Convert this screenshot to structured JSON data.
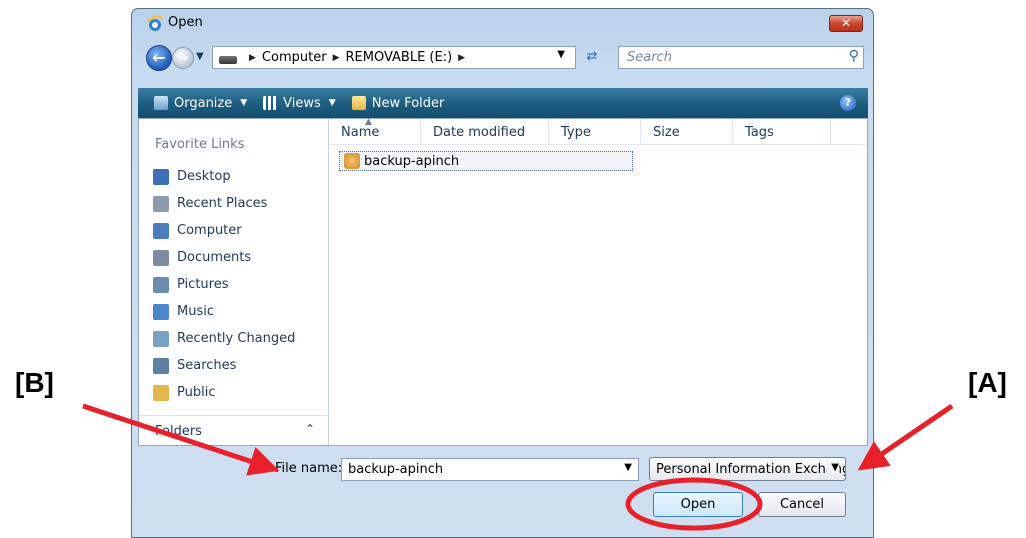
{
  "window": {
    "title": "Open",
    "close_label": "✕"
  },
  "addressbar": {
    "crumbs": [
      "Computer",
      "REMOVABLE (E:)"
    ],
    "search_placeholder": "Search"
  },
  "toolbar": {
    "organize": "Organize",
    "views": "Views",
    "new_folder": "New Folder",
    "help": "?"
  },
  "nav_pane": {
    "header": "Favorite Links",
    "items": [
      {
        "label": "Desktop",
        "icon": "desktop-icon",
        "color": "#3d6fb7"
      },
      {
        "label": "Recent Places",
        "icon": "recent-places-icon",
        "color": "#8a9aac"
      },
      {
        "label": "Computer",
        "icon": "computer-icon",
        "color": "#4a7cc0"
      },
      {
        "label": "Documents",
        "icon": "documents-icon",
        "color": "#7c8b9d"
      },
      {
        "label": "Pictures",
        "icon": "pictures-icon",
        "color": "#6b8dad"
      },
      {
        "label": "Music",
        "icon": "music-icon",
        "color": "#4a86c8"
      },
      {
        "label": "Recently Changed",
        "icon": "recently-changed-icon",
        "color": "#7aa0c4"
      },
      {
        "label": "Searches",
        "icon": "searches-icon",
        "color": "#5d7fa6"
      },
      {
        "label": "Public",
        "icon": "public-icon",
        "color": "#e3b54a"
      }
    ],
    "folders_label": "Folders"
  },
  "file_list": {
    "columns": [
      "Name",
      "Date modified",
      "Type",
      "Size",
      "Tags"
    ],
    "files": [
      {
        "name": "backup-apinch"
      }
    ]
  },
  "bottom": {
    "file_name_label": "File name:",
    "file_name_value": "backup-apinch",
    "filter_value": "Personal Information Exchang",
    "open_label": "Open",
    "cancel_label": "Cancel"
  },
  "annotations": {
    "label_b": "[B]",
    "label_a": "[A]",
    "arrow_color": "#e8202a"
  }
}
